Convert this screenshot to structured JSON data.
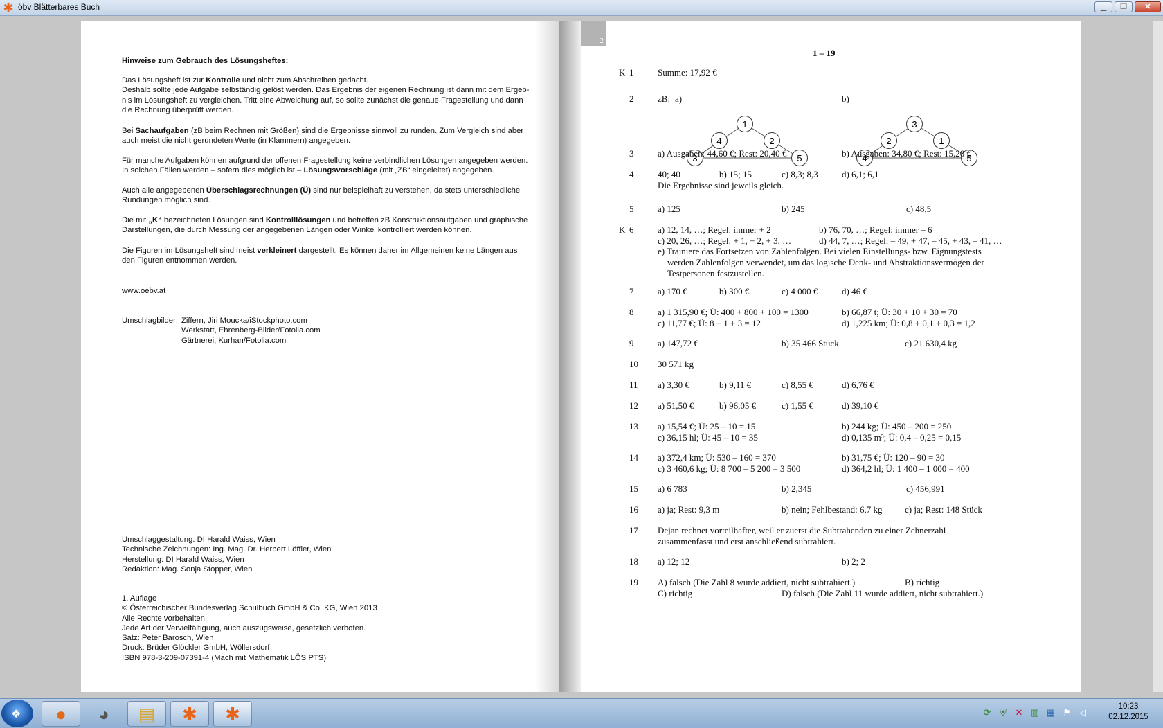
{
  "window": {
    "title": "öbv Blätterbares Buch",
    "icon": "oebv-star-icon"
  },
  "left_page": {
    "heading": "Hinweise zum Gebrauch des Lösungsheftes:",
    "p1": [
      {
        "t": "Das Lösungsheft ist zur "
      },
      {
        "t": "Kontrolle",
        "b": true
      },
      {
        "t": " und nicht zum Abschreiben gedacht."
      },
      {
        "br": true
      },
      {
        "t": "Deshalb sollte jede Aufgabe selbständig gelöst werden. Das Ergebnis der eigenen Rechnung ist dann mit dem Ergeb-"
      },
      {
        "br": true
      },
      {
        "t": "nis im Lösungsheft zu vergleichen. Tritt eine Abweichung auf, so sollte zunächst die genaue Fragestellung und dann"
      },
      {
        "br": true
      },
      {
        "t": "die Rechnung überprüft werden."
      }
    ],
    "p2": [
      {
        "t": "Bei "
      },
      {
        "t": "Sachaufgaben",
        "b": true
      },
      {
        "t": " (zB beim Rechnen mit Größen) sind die Ergebnisse sinnvoll zu runden. Zum Vergleich sind aber"
      },
      {
        "br": true
      },
      {
        "t": "auch meist die nicht gerundeten Werte (in Klammern) angegeben."
      }
    ],
    "p3": [
      {
        "t": "Für manche Aufgaben können aufgrund der offenen Fragestellung keine verbindlichen Lösungen angegeben werden."
      },
      {
        "br": true
      },
      {
        "t": "In solchen Fällen werden – sofern dies möglich ist – "
      },
      {
        "t": "Lösungsvorschläge",
        "b": true
      },
      {
        "t": " (mit „ZB“ eingeleitet) angegeben."
      }
    ],
    "p4": [
      {
        "t": "Auch alle angegebenen "
      },
      {
        "t": "Überschlagsrechnungen (Ü)",
        "b": true
      },
      {
        "t": " sind nur beispielhaft zu verstehen, da stets unterschiedliche"
      },
      {
        "br": true
      },
      {
        "t": "Rundungen möglich sind."
      }
    ],
    "p5": [
      {
        "t": "Die mit "
      },
      {
        "t": "„K“",
        "b": true
      },
      {
        "t": " bezeichneten Lösungen sind "
      },
      {
        "t": "Kontrolllösungen",
        "b": true
      },
      {
        "t": " und betreffen zB Konstruktionsaufgaben und graphische"
      },
      {
        "br": true
      },
      {
        "t": "Darstellungen, die durch Messung der angegebenen Längen oder Winkel kontrolliert werden können."
      }
    ],
    "p6": [
      {
        "t": "Die Figuren im Lösungsheft sind meist "
      },
      {
        "t": "verkleinert",
        "b": true
      },
      {
        "t": " dargestellt. Es können daher im Allgemeinen keine Längen aus"
      },
      {
        "br": true
      },
      {
        "t": "den Figuren entnommen werden."
      }
    ],
    "website": "www.oebv.at",
    "cover_label": "Umschlagbilder:",
    "cover_lines": [
      "Ziffern, Jiri Moucka/iStockphoto.com",
      "Werkstatt, Ehrenberg-Bilder/Fotolia.com",
      "Gärtnerei, Kurhan/Fotolia.com"
    ],
    "credits": [
      "Umschlaggestaltung: DI Harald Waiss, Wien",
      "Technische Zeichnungen: Ing. Mag. Dr. Herbert Löffler, Wien",
      "Herstellung: DI Harald Waiss, Wien",
      "Redaktion: Mag. Sonja Stopper, Wien"
    ],
    "imprint": [
      "1. Auflage",
      "© Österreichischer Bundesverlag Schulbuch GmbH & Co. KG, Wien 2013",
      "Alle Rechte vorbehalten.",
      "Jede Art der Vervielfältigung, auch auszugsweise, gesetzlich verboten.",
      "Satz: Peter Barosch, Wien",
      "Druck: Brüder Glöckler GmbH, Wöllersdorf",
      "ISBN 978-3-209-07391-4 (Mach mit Mathematik LÖS PTS)"
    ]
  },
  "right_page": {
    "page_number": "2",
    "heading": "1 – 19",
    "k_marker": "K",
    "zb_label": "zB:",
    "triangle_a": {
      "label": "a)",
      "top": "1",
      "left_mid": "4",
      "right_mid": "2",
      "bottom_left": "3",
      "bottom_right": "5"
    },
    "triangle_b": {
      "label": "b)",
      "top": "3",
      "left_mid": "2",
      "right_mid": "1",
      "bottom_left": "4",
      "bottom_right": "5"
    },
    "solutions": [
      {
        "id": "s1",
        "k": true,
        "num": "1",
        "lines": [
          {
            "cells": [
              "Summe: 17,92 €"
            ]
          }
        ]
      },
      {
        "id": "s3",
        "num": "3",
        "lines": [
          {
            "cells": [
              "a) Ausgaben: 44,60 €; Rest: 20,40 €",
              "b) Ausgaben: 34,80 €; Rest: 15,20 €"
            ]
          }
        ]
      },
      {
        "id": "s4",
        "num": "4",
        "lines": [
          {
            "cells": [
              "40; 40",
              "b) 15; 15",
              "c) 8,3; 8,3",
              "d) 6,1; 6,1"
            ]
          },
          {
            "cells": [
              "Die Ergebnisse sind jeweils gleich."
            ]
          }
        ]
      },
      {
        "id": "s5",
        "num": "5",
        "lines": [
          {
            "cells": [
              "a) 125",
              "b) 245",
              "c) 48,5"
            ]
          }
        ]
      },
      {
        "id": "s6",
        "k": true,
        "num": "6",
        "lines": [
          {
            "cells": [
              "a) 12, 14, …; Regel: immer + 2",
              "b) 76, 70, …; Regel: immer – 6"
            ]
          },
          {
            "cells": [
              "c) 20, 26, …; Regel: + 1, + 2, + 3, …",
              "d) 44, 7, …; Regel: – 49, + 47, – 45, + 43, – 41, …"
            ]
          },
          {
            "cells": [
              "e) Trainiere das Fortsetzen von Zahlenfolgen. Bei vielen Einstellungs- bzw. Eignungstests"
            ]
          },
          {
            "cells": [
              "werden Zahlenfolgen verwendet, um das logische Denk- und Abstraktionsvermögen der"
            ],
            "indent": true
          },
          {
            "cells": [
              "Testpersonen festzustellen."
            ],
            "indent": true
          }
        ]
      },
      {
        "id": "s7",
        "num": "7",
        "lines": [
          {
            "cells": [
              "a) 170 €",
              "b) 300 €",
              "c) 4 000 €",
              "d) 46 €"
            ]
          }
        ]
      },
      {
        "id": "s8",
        "num": "8",
        "lines": [
          {
            "cells": [
              "a) 1 315,90 €; Ü: 400 + 800 + 100 = 1300",
              "b) 66,87 t; Ü: 30 + 10 + 30 = 70"
            ]
          },
          {
            "cells": [
              "c) 11,77 €; Ü: 8 + 1 + 3 = 12",
              "d) 1,225 km; Ü: 0,8 + 0,1 + 0,3 = 1,2"
            ]
          }
        ]
      },
      {
        "id": "s9",
        "num": "9",
        "lines": [
          {
            "cells": [
              "a) 147,72 €",
              "b) 35 466 Stück",
              "c) 21 630,4 kg"
            ]
          }
        ]
      },
      {
        "id": "s10",
        "num": "10",
        "lines": [
          {
            "cells": [
              "30 571 kg"
            ]
          }
        ]
      },
      {
        "id": "s11",
        "num": "11",
        "lines": [
          {
            "cells": [
              "a) 3,30 €",
              "b) 9,11 €",
              "c) 8,55 €",
              "d) 6,76 €"
            ]
          }
        ]
      },
      {
        "id": "s12",
        "num": "12",
        "lines": [
          {
            "cells": [
              "a) 51,50 €",
              "b) 96,05 €",
              "c) 1,55 €",
              "d) 39,10 €"
            ]
          }
        ]
      },
      {
        "id": "s13",
        "num": "13",
        "lines": [
          {
            "cells": [
              "a) 15,54 €; Ü: 25 – 10 = 15",
              "b) 244 kg; Ü: 450 – 200 = 250"
            ]
          },
          {
            "cells": [
              "c) 36,15 hl; Ü: 45 – 10 = 35",
              "d) 0,135 m³; Ü: 0,4 – 0,25 = 0,15"
            ]
          }
        ]
      },
      {
        "id": "s14",
        "num": "14",
        "lines": [
          {
            "cells": [
              "a) 372,4 km; Ü: 530 – 160 = 370",
              "b) 31,75 €; Ü: 120 – 90 = 30"
            ]
          },
          {
            "cells": [
              "c) 3 460,6 kg; Ü: 8 700 – 5 200 = 3 500",
              "d) 364,2 hl; Ü: 1 400 – 1 000 = 400"
            ]
          }
        ]
      },
      {
        "id": "s15",
        "num": "15",
        "lines": [
          {
            "cells": [
              "a) 6 783",
              "b) 2,345",
              "c) 456,991"
            ]
          }
        ]
      },
      {
        "id": "s16",
        "num": "16",
        "lines": [
          {
            "cells": [
              "a) ja; Rest: 9,3 m",
              "b) nein; Fehlbestand: 6,7 kg",
              "c) ja; Rest: 148 Stück"
            ]
          }
        ]
      },
      {
        "id": "s17",
        "num": "17",
        "lines": [
          {
            "cells": [
              "Dejan rechnet vorteilhafter, weil er zuerst die Subtrahenden zu einer Zehnerzahl"
            ]
          },
          {
            "cells": [
              "zusammenfasst und erst anschließend subtrahiert."
            ]
          }
        ]
      },
      {
        "id": "s18",
        "num": "18",
        "lines": [
          {
            "cells": [
              "a) 12; 12",
              "b) 2; 2"
            ]
          }
        ]
      },
      {
        "id": "s19",
        "num": "19",
        "lines": [
          {
            "cells": [
              "A) falsch (Die Zahl 8 wurde addiert, nicht subtrahiert.)",
              "B) richtig"
            ]
          },
          {
            "cells": [
              "C) richtig",
              "D) falsch (Die Zahl 11 wurde addiert, nicht subtrahiert.)"
            ]
          }
        ]
      }
    ]
  },
  "taskbar": {
    "items": [
      {
        "id": "tb-firefox",
        "name": "firefox-taskbar-button",
        "icon": "firefox-icon",
        "glyph": "●"
      },
      {
        "id": "tb-gimp",
        "name": "gimp-taskbar-button",
        "icon": "gimp-icon",
        "glyph": "◕"
      },
      {
        "id": "tb-explorer",
        "name": "explorer-taskbar-button",
        "icon": "folder-icon",
        "glyph": "▤"
      },
      {
        "id": "tb-oebv1",
        "name": "oebv-taskbar-button-1",
        "icon": "oebv-star-icon",
        "glyph": "✱"
      },
      {
        "id": "tb-oebv2",
        "name": "oebv-taskbar-button-2",
        "icon": "oebv-star-icon",
        "glyph": "✱"
      }
    ],
    "tray": [
      {
        "name": "network-sync-icon",
        "glyph": "⟳",
        "color": "#2a8a2a"
      },
      {
        "name": "security-icon",
        "glyph": "⛨",
        "color": "#3a7a3a"
      },
      {
        "name": "error-icon",
        "glyph": "✕",
        "color": "#c8102e"
      },
      {
        "name": "printer-icon",
        "glyph": "▥",
        "color": "#3b8d3b"
      },
      {
        "name": "update-icon",
        "glyph": "▦",
        "color": "#2b6cb0"
      },
      {
        "name": "flag-icon",
        "glyph": "⚑",
        "color": "#ffffff"
      },
      {
        "name": "volume-icon",
        "glyph": "◁",
        "color": "#ffffff"
      }
    ],
    "clock": {
      "time": "10:23",
      "date": "02.12.2015"
    }
  }
}
